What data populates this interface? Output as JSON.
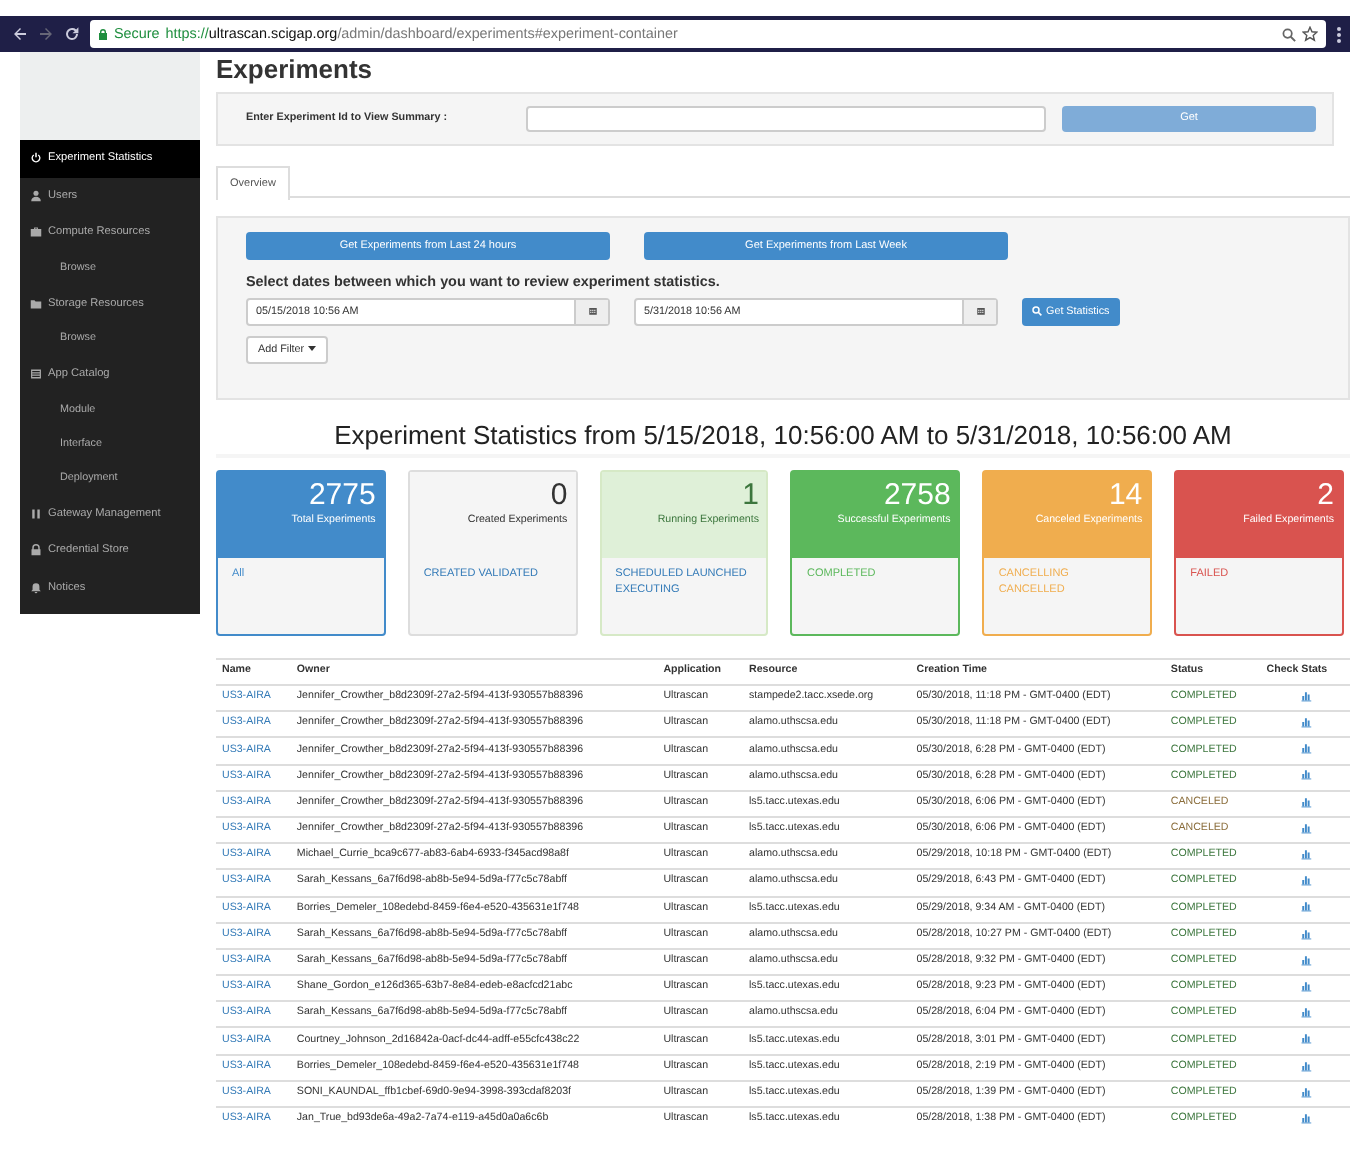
{
  "browser": {
    "secure_label": "Secure",
    "url_scheme": "https://",
    "url_host": "ultrascan.scigap.org",
    "url_path": "/admin/dashboard/experiments#experiment-container"
  },
  "sidebar": {
    "items": [
      {
        "label": "Experiment Statistics",
        "selected": true
      },
      {
        "label": "Users",
        "selected": false
      },
      {
        "label": "Compute Resources",
        "selected": false,
        "children": [
          {
            "label": "Browse",
            "selected": false
          }
        ]
      },
      {
        "label": "Storage Resources",
        "selected": false,
        "children": [
          {
            "label": "Browse",
            "selected": false
          }
        ]
      },
      {
        "label": "App Catalog",
        "selected": false,
        "children": [
          {
            "label": "Module",
            "selected": false
          },
          {
            "label": "Interface",
            "selected": false
          },
          {
            "label": "Deployment",
            "selected": false
          }
        ]
      },
      {
        "label": "Gateway Management",
        "selected": false
      },
      {
        "label": "Credential Store",
        "selected": false
      },
      {
        "label": "Notices",
        "selected": false
      }
    ]
  },
  "page_title": "Experiments",
  "summary": {
    "label": "Enter Experiment Id to View Summary :",
    "button": "Get"
  },
  "tabs": [
    {
      "label": "Overview",
      "selected": true
    }
  ],
  "filters": {
    "quick_buttons": [
      "Get Experiments from Last 24 hours",
      "Get Experiments from Last Week"
    ],
    "dates_label": "Select dates between which you want to review experiment statistics.",
    "from_date": "05/15/2018 10:56 AM",
    "to_date": "5/31/2018 10:56 AM",
    "stats_button": "Get Statistics",
    "add_filter": "Add Filter"
  },
  "stats_heading": "Experiment Statistics from 5/15/2018, 10:56:00 AM to 5/31/2018, 10:56:00 AM",
  "cards": [
    {
      "kind": "total",
      "count": "2775",
      "label": "Total Experiments",
      "states": "All"
    },
    {
      "kind": "created",
      "count": "0",
      "label": "Created Experiments",
      "states": "CREATED VALIDATED"
    },
    {
      "kind": "running",
      "count": "1",
      "label": "Running Experiments",
      "states": "SCHEDULED LAUNCHED EXECUTING"
    },
    {
      "kind": "successful",
      "count": "2758",
      "label": "Successful Experiments",
      "states": "COMPLETED"
    },
    {
      "kind": "canceled",
      "count": "14",
      "label": "Canceled Experiments",
      "states": "CANCELLING CANCELLED"
    },
    {
      "kind": "failed",
      "count": "2",
      "label": "Failed Experiments",
      "states": "FAILED"
    }
  ],
  "table": {
    "columns": [
      "Name",
      "Owner",
      "Application",
      "Resource",
      "Creation Time",
      "Status",
      "Check Stats"
    ],
    "rows": [
      {
        "name": "US3-AIRA",
        "owner": "Jennifer_Crowther_b8d2309f-27a2-5f94-413f-930557b88396",
        "application": "Ultrascan",
        "resource": "stampede2.tacc.xsede.org",
        "time": "05/30/2018, 11:18 PM - GMT-0400 (EDT)",
        "status": "COMPLETED",
        "color": "#3c763d"
      },
      {
        "name": "US3-AIRA",
        "owner": "Jennifer_Crowther_b8d2309f-27a2-5f94-413f-930557b88396",
        "application": "Ultrascan",
        "resource": "alamo.uthscsa.edu",
        "time": "05/30/2018, 11:18 PM - GMT-0400 (EDT)",
        "status": "COMPLETED",
        "color": "#3c763d"
      },
      {
        "name": "US3-AIRA",
        "owner": "Jennifer_Crowther_b8d2309f-27a2-5f94-413f-930557b88396",
        "application": "Ultrascan",
        "resource": "alamo.uthscsa.edu",
        "time": "05/30/2018, 6:28 PM - GMT-0400 (EDT)",
        "status": "COMPLETED",
        "color": "#3c763d"
      },
      {
        "name": "US3-AIRA",
        "owner": "Jennifer_Crowther_b8d2309f-27a2-5f94-413f-930557b88396",
        "application": "Ultrascan",
        "resource": "alamo.uthscsa.edu",
        "time": "05/30/2018, 6:28 PM - GMT-0400 (EDT)",
        "status": "COMPLETED",
        "color": "#3c763d"
      },
      {
        "name": "US3-AIRA",
        "owner": "Jennifer_Crowther_b8d2309f-27a2-5f94-413f-930557b88396",
        "application": "Ultrascan",
        "resource": "ls5.tacc.utexas.edu",
        "time": "05/30/2018, 6:06 PM - GMT-0400 (EDT)",
        "status": "CANCELED",
        "color": "#8a6d3b"
      },
      {
        "name": "US3-AIRA",
        "owner": "Jennifer_Crowther_b8d2309f-27a2-5f94-413f-930557b88396",
        "application": "Ultrascan",
        "resource": "ls5.tacc.utexas.edu",
        "time": "05/30/2018, 6:06 PM - GMT-0400 (EDT)",
        "status": "CANCELED",
        "color": "#8a6d3b"
      },
      {
        "name": "US3-AIRA",
        "owner": "Michael_Currie_bca9c677-ab83-6ab4-6933-f345acd98a8f",
        "application": "Ultrascan",
        "resource": "alamo.uthscsa.edu",
        "time": "05/29/2018, 10:18 PM - GMT-0400 (EDT)",
        "status": "COMPLETED",
        "color": "#3c763d"
      },
      {
        "name": "US3-AIRA",
        "owner": "Sarah_Kessans_6a7f6d98-ab8b-5e94-5d9a-f77c5c78abff",
        "application": "Ultrascan",
        "resource": "alamo.uthscsa.edu",
        "time": "05/29/2018, 6:43 PM - GMT-0400 (EDT)",
        "status": "COMPLETED",
        "color": "#3c763d"
      },
      {
        "name": "US3-AIRA",
        "owner": "Borries_Demeler_108edebd-8459-f6e4-e520-435631e1f748",
        "application": "Ultrascan",
        "resource": "ls5.tacc.utexas.edu",
        "time": "05/29/2018, 9:34 AM - GMT-0400 (EDT)",
        "status": "COMPLETED",
        "color": "#3c763d"
      },
      {
        "name": "US3-AIRA",
        "owner": "Sarah_Kessans_6a7f6d98-ab8b-5e94-5d9a-f77c5c78abff",
        "application": "Ultrascan",
        "resource": "alamo.uthscsa.edu",
        "time": "05/28/2018, 10:27 PM - GMT-0400 (EDT)",
        "status": "COMPLETED",
        "color": "#3c763d"
      },
      {
        "name": "US3-AIRA",
        "owner": "Sarah_Kessans_6a7f6d98-ab8b-5e94-5d9a-f77c5c78abff",
        "application": "Ultrascan",
        "resource": "alamo.uthscsa.edu",
        "time": "05/28/2018, 9:32 PM - GMT-0400 (EDT)",
        "status": "COMPLETED",
        "color": "#3c763d"
      },
      {
        "name": "US3-AIRA",
        "owner": "Shane_Gordon_e126d365-63b7-8e84-edeb-e8acfcd21abc",
        "application": "Ultrascan",
        "resource": "ls5.tacc.utexas.edu",
        "time": "05/28/2018, 9:23 PM - GMT-0400 (EDT)",
        "status": "COMPLETED",
        "color": "#3c763d"
      },
      {
        "name": "US3-AIRA",
        "owner": "Sarah_Kessans_6a7f6d98-ab8b-5e94-5d9a-f77c5c78abff",
        "application": "Ultrascan",
        "resource": "alamo.uthscsa.edu",
        "time": "05/28/2018, 6:04 PM - GMT-0400 (EDT)",
        "status": "COMPLETED",
        "color": "#3c763d"
      },
      {
        "name": "US3-AIRA",
        "owner": "Courtney_Johnson_2d16842a-0acf-dc44-adff-e55cfc438c22",
        "application": "Ultrascan",
        "resource": "ls5.tacc.utexas.edu",
        "time": "05/28/2018, 3:01 PM - GMT-0400 (EDT)",
        "status": "COMPLETED",
        "color": "#3c763d"
      },
      {
        "name": "US3-AIRA",
        "owner": "Borries_Demeler_108edebd-8459-f6e4-e520-435631e1f748",
        "application": "Ultrascan",
        "resource": "ls5.tacc.utexas.edu",
        "time": "05/28/2018, 2:19 PM - GMT-0400 (EDT)",
        "status": "COMPLETED",
        "color": "#3c763d"
      },
      {
        "name": "US3-AIRA",
        "owner": "SONI_KAUNDAL_ffb1cbef-69d0-9e94-3998-393cdaf8203f",
        "application": "Ultrascan",
        "resource": "ls5.tacc.utexas.edu",
        "time": "05/28/2018, 1:39 PM - GMT-0400 (EDT)",
        "status": "COMPLETED",
        "color": "#3c763d"
      },
      {
        "name": "US3-AIRA",
        "owner": "Jan_True_bd93de6a-49a2-7a74-e119-a45d0a0a6c6b",
        "application": "Ultrascan",
        "resource": "ls5.tacc.utexas.edu",
        "time": "05/28/2018, 1:38 PM - GMT-0400 (EDT)",
        "status": "COMPLETED",
        "color": "#3c763d"
      }
    ]
  }
}
